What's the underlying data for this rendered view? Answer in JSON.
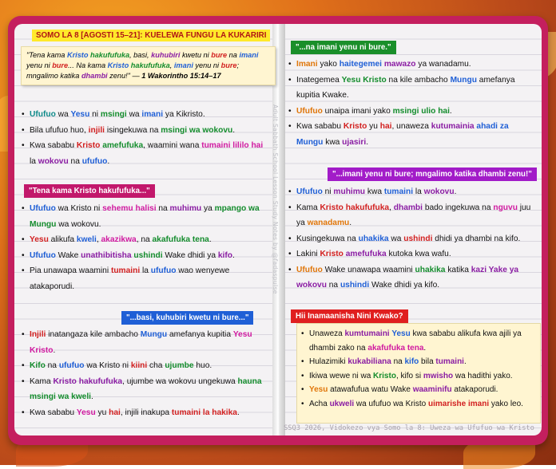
{
  "left": {
    "header": "SOMO LA 8 [AGOSTI 15–21]: KUELEWA FUNGU LA KUKARIRI",
    "quote": {
      "segments": [
        "\"Tena kama ",
        "Kristo",
        " ",
        "hakufufuka",
        ", basi, ",
        "kuhubiri",
        " kwetu ni ",
        "bure",
        " na ",
        "imani",
        " yenu ni ",
        "bure",
        "... Na kama ",
        "Kristo",
        " ",
        "hakufufuka",
        ", ",
        "imani",
        " yenu ni ",
        "bure",
        "; mngalimo katika ",
        "dhambi",
        " zenu!\" — ",
        "1 Wakorintho 15:14–17"
      ]
    },
    "bullets1": [
      [
        "Ufufuo",
        " wa ",
        "Yesu",
        " ni ",
        "msingi",
        " wa ",
        "imani",
        " ya Kikristo."
      ],
      [
        "Bila ufufuo huo, ",
        "injili",
        " isingekuwa na ",
        "msingi wa wokovu",
        "."
      ],
      [
        "Kwa sababu ",
        "Kristo",
        " ",
        "amefufuka",
        ", waamini wana ",
        "tumaini lililo hai",
        " la ",
        "wokovu",
        " na ",
        "ufufuo",
        "."
      ]
    ],
    "sticker1": "\"Tena kama Kristo hakufufuka...\"",
    "bullets2": [
      [
        "Ufufuo",
        " wa Kristo ni ",
        "sehemu halisi",
        " na ",
        "muhimu",
        " ya ",
        "mpango wa Mungu",
        " wa wokovu."
      ],
      [
        "Yesu",
        " alikufa ",
        "kweli",
        ", ",
        "akazikwa",
        ", na ",
        "akafufuka tena",
        "."
      ],
      [
        "Ufufuo",
        " Wake ",
        "unathibitisha",
        " ",
        "ushindi",
        " Wake dhidi ya ",
        "kifo",
        "."
      ],
      [
        "Pia unawapa waamini ",
        "tumaini",
        " la ",
        "ufufuo",
        " wao wenyewe atakaporudi."
      ]
    ],
    "sticker2": "\"...basi, kuhubiri kwetu ni bure...\"",
    "bullets3": [
      [
        "Injili",
        " inatangaza kile ambacho ",
        "Mungu",
        " amefanya kupitia ",
        "Yesu Kristo",
        "."
      ],
      [
        "Kifo",
        " na ",
        "ufufuo",
        " wa Kristo ni ",
        "kiini",
        " cha ",
        "ujumbe",
        " huo."
      ],
      [
        "Kama ",
        "Kristo",
        " ",
        "hakufufuka",
        ", ujumbe wa wokovu ungekuwa ",
        "hauna msingi wa kweli",
        "."
      ],
      [
        "Kwa sababu ",
        "Yesu",
        " yu ",
        "hai",
        ", injili inakupa ",
        "tumaini la hakika",
        "."
      ]
    ]
  },
  "right": {
    "sticker1": "\"...na imani yenu ni bure.\"",
    "bullets1": [
      [
        "Imani",
        " yako ",
        "haitegemei",
        " ",
        "mawazo",
        " ya wanadamu."
      ],
      [
        "Inategemea ",
        "Yesu Kristo",
        " na kile ambacho ",
        "Mungu",
        " amefanya kupitia Kwake."
      ],
      [
        "Ufufuo",
        " unaipa imani yako ",
        "msingi ulio hai",
        "."
      ],
      [
        "Kwa sababu ",
        "Kristo",
        " yu ",
        "hai",
        ", unaweza ",
        "kutumainia",
        " ",
        "ahadi za Mungu",
        " kwa ",
        "ujasiri",
        "."
      ]
    ],
    "sticker2": "\"...imani yenu ni bure; mngalimo katika dhambi zenu!\"",
    "bullets2": [
      [
        "Ufufuo",
        " ni ",
        "muhimu",
        " kwa ",
        "tumaini",
        " la ",
        "wokovu",
        "."
      ],
      [
        "Kama ",
        "Kristo",
        " ",
        "hakufufuka",
        ", ",
        "dhambi",
        " bado ingekuwa na ",
        "nguvu",
        " juu ya ",
        "wanadamu",
        "."
      ],
      [
        "Kusingekuwa na ",
        "uhakika",
        " wa ",
        "ushindi",
        " dhidi ya dhambi na kifo."
      ],
      [
        "Lakini ",
        "Kristo",
        " ",
        "amefufuka",
        " kutoka kwa wafu."
      ],
      [
        "Ufufuo",
        " Wake unawapa waamini ",
        "uhakika",
        " katika ",
        "kazi Yake ya wokovu",
        " na ",
        "ushindi",
        " Wake dhidi ya kifo."
      ]
    ],
    "sticker3": "Hii Inamaanisha Nini Kwako?",
    "bullets3": [
      [
        "Unaweza ",
        "kumtumaini",
        " ",
        "Yesu",
        " kwa sababu alikufa kwa ajili ya dhambi zako na ",
        "akafufuka tena",
        "."
      ],
      [
        "Hulazimiki ",
        "kukabiliana",
        " na ",
        "kifo",
        " bila ",
        "tumaini",
        "."
      ],
      [
        "Ikiwa wewe ni wa ",
        "Kristo",
        ", kifo si ",
        "mwisho",
        " wa hadithi yako."
      ],
      [
        "Yesu",
        " atawafufua watu Wake ",
        "waaminifu",
        " atakaporudi."
      ],
      [
        "Acha ",
        "ukweli",
        " wa ufufuo wa Kristo ",
        "uimarishe",
        " ",
        "imani",
        " yako leo."
      ]
    ],
    "footer": "SSQ3 2026, Vidokezo vya Somo la 8: Uweza wa Ufufuo wa Kristo"
  },
  "watermark": "Adult Sabbath School Lesson Study Notes by @fadaspulse",
  "colors": {
    "green": "#138c2c",
    "red": "#d22020",
    "blue": "#1f5fd6",
    "purple": "#8a1da3",
    "magenta": "#d01aa0",
    "orange": "#e0760a",
    "book": "#c41f5e"
  }
}
